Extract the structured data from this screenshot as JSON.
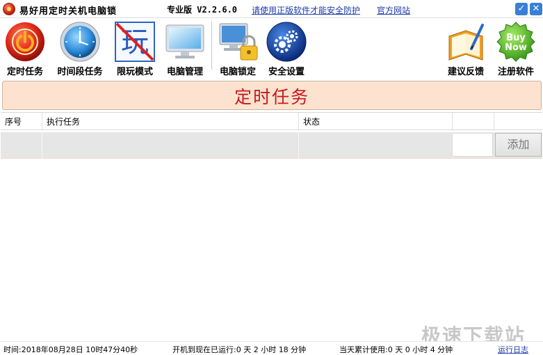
{
  "window": {
    "title": "易好用定时关机电脑锁",
    "version": "专业版 V2.2.6.0",
    "link_secure": "请使用正版软件才能安全防护",
    "link_site": "官方网站",
    "minimize_glyph": "✓",
    "close_glyph": "✕"
  },
  "toolbar": {
    "items": [
      {
        "label": "定时任务",
        "icon": "power-icon"
      },
      {
        "label": "时间段任务",
        "icon": "clock-icon"
      },
      {
        "label": "限玩模式",
        "icon": "no-play-icon",
        "icon_text": "玩"
      },
      {
        "label": "电脑管理",
        "icon": "monitor-icon"
      },
      {
        "label": "电脑锁定",
        "icon": "computer-lock-icon"
      },
      {
        "label": "安全设置",
        "icon": "gears-icon"
      },
      {
        "label": "建议反馈",
        "icon": "feedback-notebook-icon"
      },
      {
        "label": "注册软件",
        "icon": "buy-now-badge-icon",
        "icon_text_1": "Buy",
        "icon_text_2": "Now"
      }
    ]
  },
  "section": {
    "title": "定时任务"
  },
  "table": {
    "columns": [
      "序号",
      "执行任务",
      "状态"
    ],
    "input_value": "",
    "add_label": "添加"
  },
  "watermark": "极速下载站",
  "status": {
    "time": "时间:2018年08月28日 10时47分40秒",
    "uptime": "开机到现在已运行:0 天 2 小时 18 分钟",
    "today": "当天累计使用:0 天 0 小时 4 分钟",
    "log": "运行日志"
  },
  "colors": {
    "banner_bg": "#fde3cf",
    "banner_text": "#c8181e",
    "link": "#1a3aa8"
  }
}
